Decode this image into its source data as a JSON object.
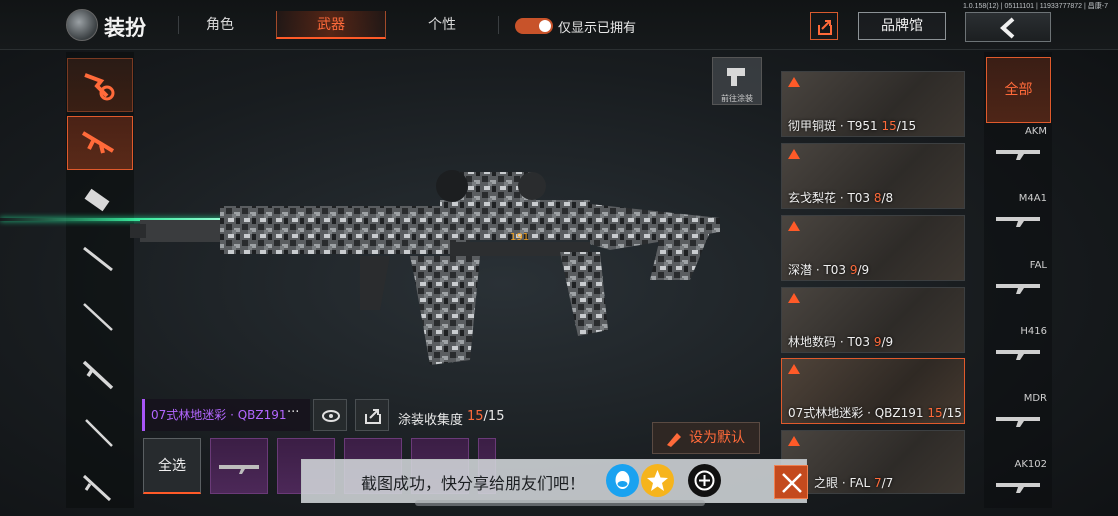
{
  "app": {
    "version": "1.0.158(12) | 05111101 | 11933777872 | 昌康-7",
    "title": "装扮"
  },
  "tabs": [
    {
      "label": "角色"
    },
    {
      "label": "武器"
    },
    {
      "label": "个性"
    }
  ],
  "filter_toggle": {
    "label": "仅显示已拥有",
    "on": true
  },
  "header": {
    "brand_label": "品牌馆"
  },
  "goto_paint": {
    "label": "前往涂装"
  },
  "skins": [
    {
      "name": "彻甲铜斑 · T951 ",
      "owned": "15",
      "total": "/15"
    },
    {
      "name": "玄戈梨花 · T03 ",
      "owned": "8",
      "total": "/8"
    },
    {
      "name": "深潜 · T03 ",
      "owned": "9",
      "total": "/9"
    },
    {
      "name": "林地数码 · T03 ",
      "owned": "9",
      "total": "/9"
    },
    {
      "name": "07式林地迷彩 · QBZ191 ",
      "owned": "15",
      "total": "/15"
    },
    {
      "name": "之眼 · FAL ",
      "owned": "7",
      "total": "/7"
    }
  ],
  "weapon_filters": [
    {
      "label": "全部"
    },
    {
      "label": "AKM"
    },
    {
      "label": "M4A1"
    },
    {
      "label": "FAL"
    },
    {
      "label": "H416"
    },
    {
      "label": "MDR"
    },
    {
      "label": "AK102"
    }
  ],
  "selected_skin": {
    "name": "07式林地迷彩 · QBZ191",
    "more": "···",
    "collection_label": "涂装收集度",
    "collection_owned": "15",
    "collection_total": "/15"
  },
  "actions": {
    "set_default": "设为默认",
    "select_all": "全选"
  },
  "toast": {
    "text": "截图成功，快分享给朋友们吧！"
  },
  "colors": {
    "accent": "#ff5a28",
    "purple": "#b266ff",
    "laser": "#3cffaa"
  }
}
